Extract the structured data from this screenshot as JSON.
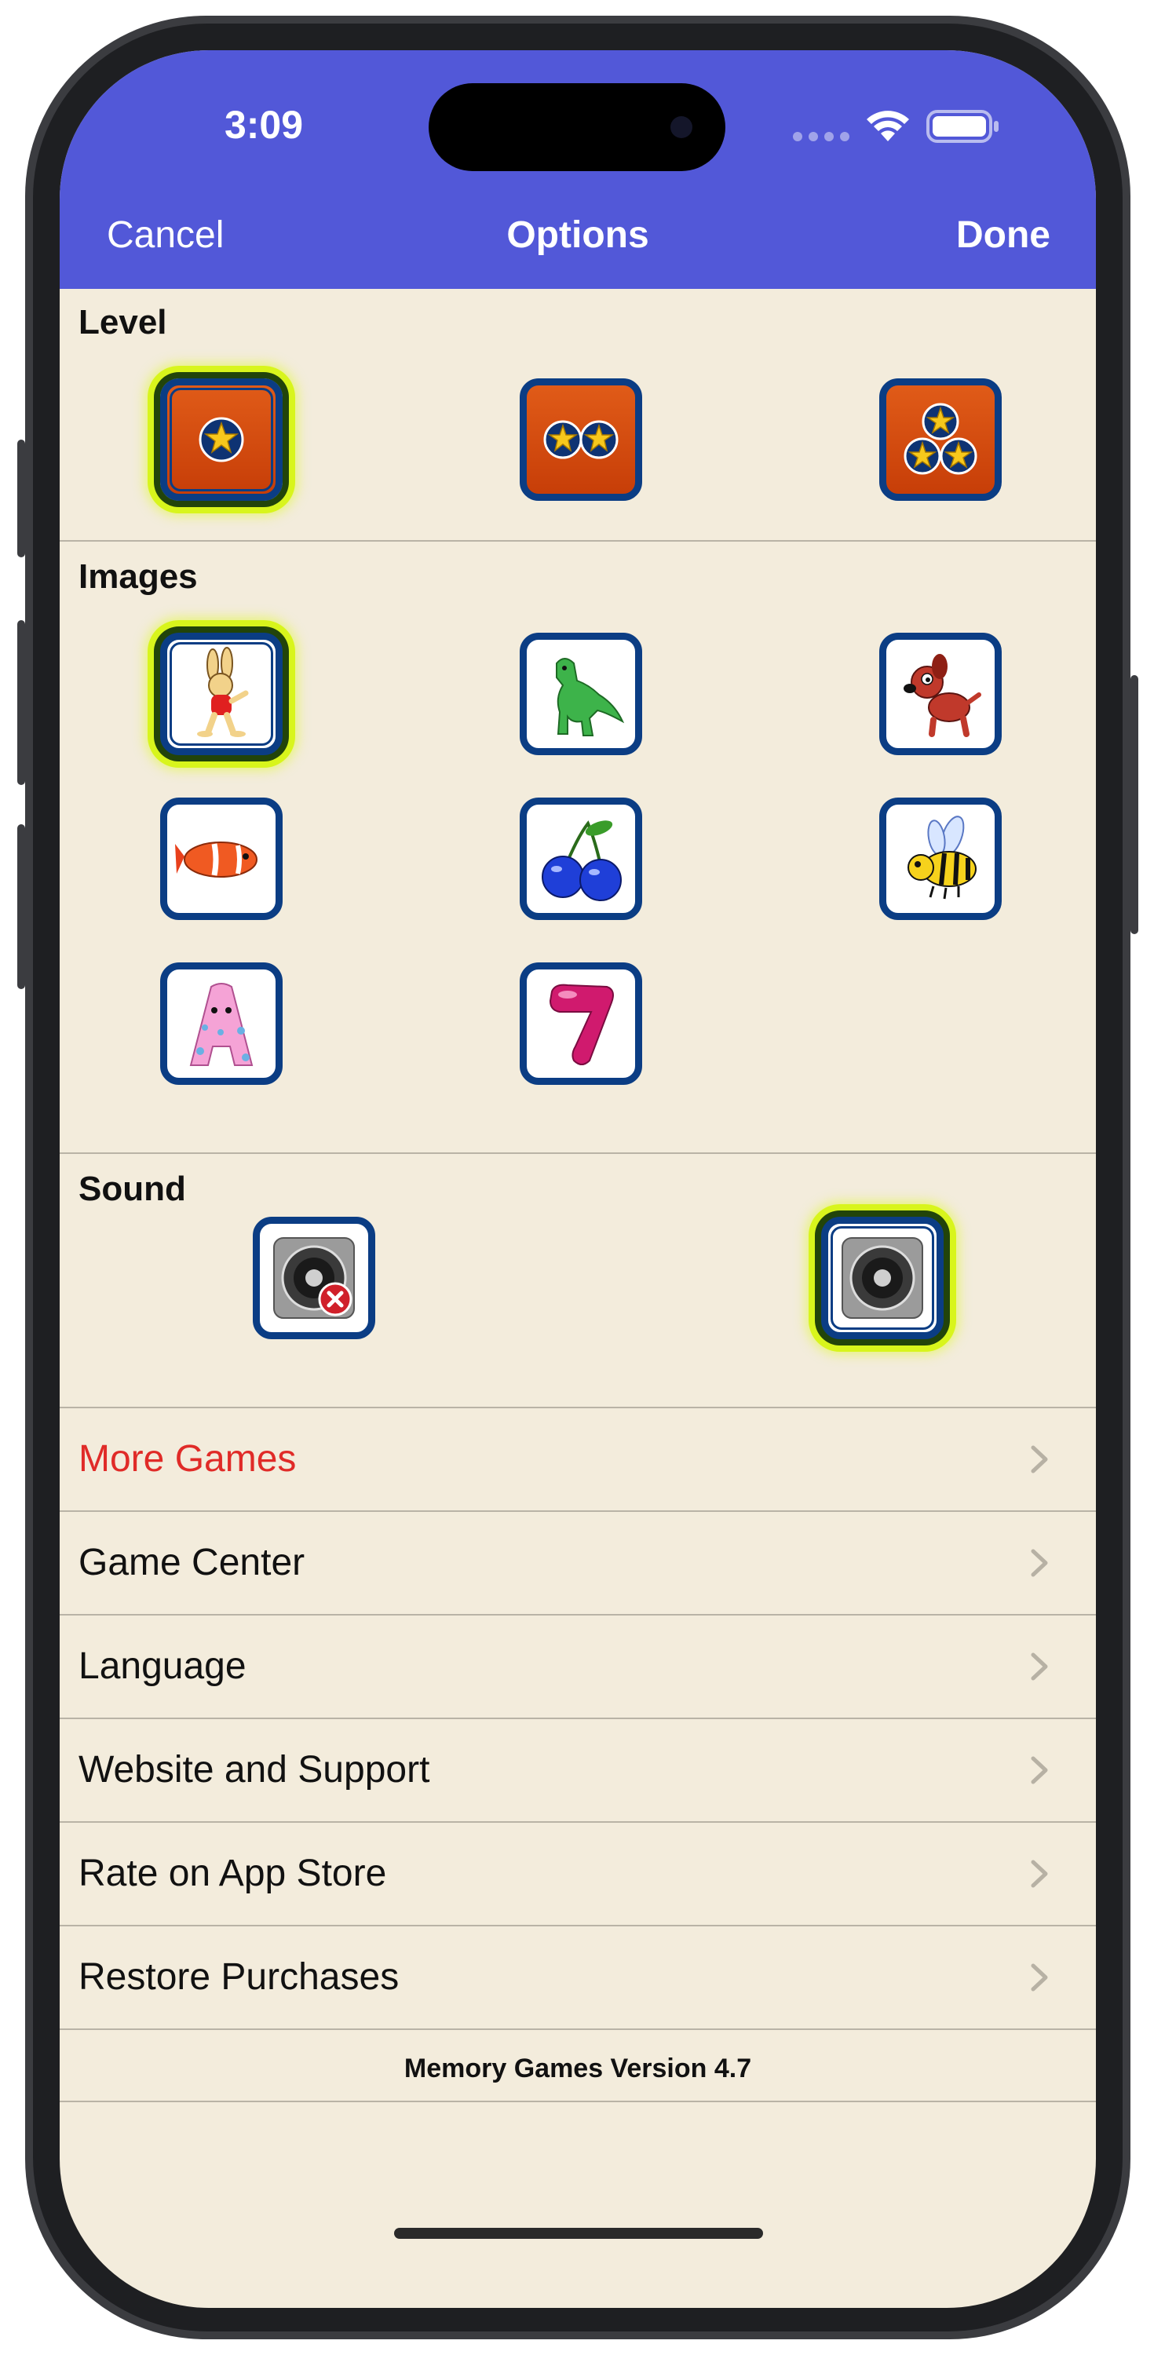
{
  "status_bar": {
    "time": "3:09"
  },
  "nav": {
    "cancel_label": "Cancel",
    "title": "Options",
    "done_label": "Done"
  },
  "level": {
    "title": "Level",
    "options": [
      {
        "stars": 1,
        "selected": true
      },
      {
        "stars": 2,
        "selected": false
      },
      {
        "stars": 3,
        "selected": false
      }
    ]
  },
  "images": {
    "title": "Images",
    "options": [
      {
        "icon": "bunny-icon",
        "selected": true
      },
      {
        "icon": "dinosaur-icon",
        "selected": false
      },
      {
        "icon": "dog-icon",
        "selected": false
      },
      {
        "icon": "clownfish-icon",
        "selected": false
      },
      {
        "icon": "cherries-icon",
        "selected": false
      },
      {
        "icon": "bee-icon",
        "selected": false
      },
      {
        "icon": "letter-a-icon",
        "selected": false
      },
      {
        "icon": "number-7-icon",
        "selected": false
      }
    ]
  },
  "sound": {
    "title": "Sound",
    "options": [
      {
        "icon": "speaker-muted-icon",
        "selected": false
      },
      {
        "icon": "speaker-icon",
        "selected": true
      }
    ]
  },
  "menu": {
    "items": [
      {
        "label": "More Games",
        "highlight": true
      },
      {
        "label": "Game Center",
        "highlight": false
      },
      {
        "label": "Language",
        "highlight": false
      },
      {
        "label": "Website and Support",
        "highlight": false
      },
      {
        "label": "Rate on App Store",
        "highlight": false
      },
      {
        "label": "Restore Purchases",
        "highlight": false
      }
    ]
  },
  "footer": {
    "version_text": "Memory Games Version 4.7"
  },
  "colors": {
    "nav_bar": "#5258d8",
    "background": "#f3ecdc",
    "tile_border": "#0b3d84",
    "selection_glow": "#d8f51c",
    "highlight_text": "#e02b28"
  }
}
